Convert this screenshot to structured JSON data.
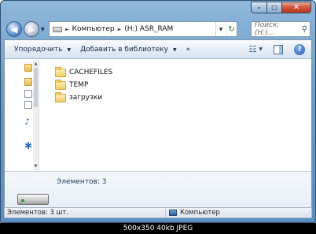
{
  "window": {
    "caption_buttons": {
      "minimize": "–",
      "maximize": "□",
      "close": "✕"
    }
  },
  "address_bar": {
    "back_icon": "back-arrow-icon",
    "forward_icon": "forward-arrow-icon",
    "breadcrumb": [
      "Компьютер",
      "(H:) ASR_RAM"
    ],
    "separator": "►",
    "dropdown": "▼",
    "refresh": "↻"
  },
  "search": {
    "placeholder": "Поиск: (H:)...",
    "icon": "magnifier-icon"
  },
  "toolbar": {
    "organize_label": "Упорядочить",
    "add_to_library_label": "Добавить в библиотеку",
    "more_label": "»",
    "dropdown_arrow": "▼",
    "view_icon": "☷",
    "help_label": "?"
  },
  "files": [
    {
      "name": "CACHEFILES"
    },
    {
      "name": "TEMP"
    },
    {
      "name": "загрузки"
    }
  ],
  "details": {
    "items_count_text": "Элементов: 3"
  },
  "status_bar": {
    "left_text": "Элементов: 3 шт.",
    "right_text": "Компьютер",
    "grip": "⋰"
  },
  "caption_bar": {
    "text": "500x350  40kb  JPEG"
  }
}
